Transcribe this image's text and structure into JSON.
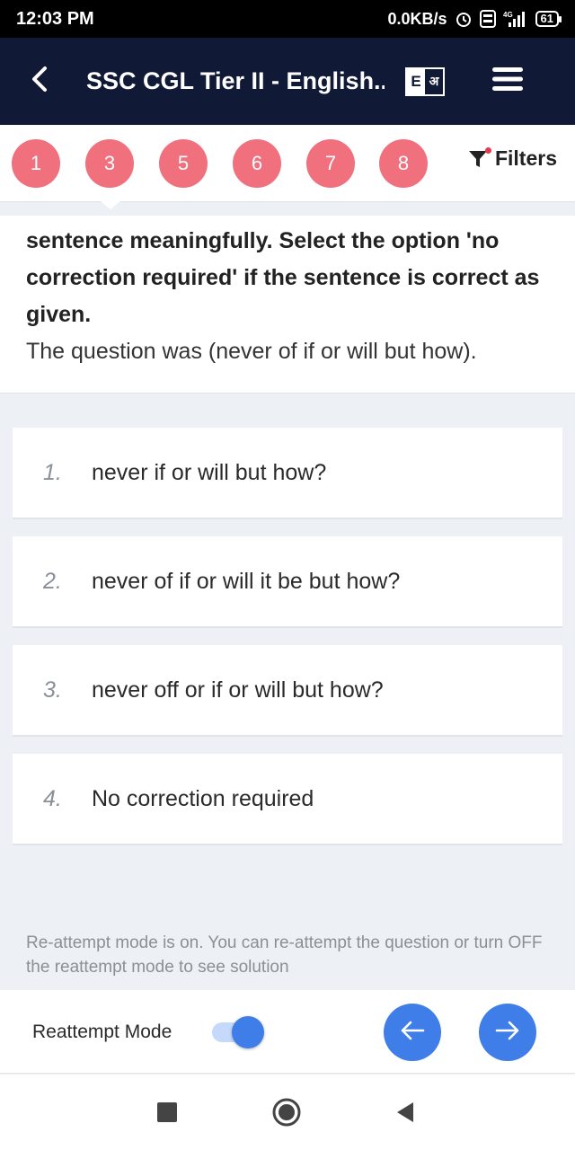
{
  "statusbar": {
    "time": "12:03 PM",
    "net_speed": "0.0KB/s",
    "volte": "Vo LTE",
    "network": "4G",
    "battery": "61"
  },
  "appbar": {
    "title": "SSC CGL Tier II - English...",
    "lang_en": "E",
    "lang_hi": "अ"
  },
  "question_nav": {
    "numbers": [
      "1",
      "3",
      "5",
      "6",
      "7",
      "8"
    ],
    "filters_label": "Filters"
  },
  "question": {
    "instruction": "sentence meaningfully. Select the option 'no correction required' if the sentence is correct as given.",
    "sentence": "The question was (never of if or will but how)."
  },
  "options": [
    {
      "num": "1.",
      "text": "never if or will but how?"
    },
    {
      "num": "2.",
      "text": "never of if or will it be but how?"
    },
    {
      "num": "3.",
      "text": "never off or if or will but how?"
    },
    {
      "num": "4.",
      "text": "No correction required"
    }
  ],
  "note": "Re-attempt mode is on. You can re-attempt the question or turn OFF the reattempt mode to see solution",
  "bottombar": {
    "reattempt_label": "Reattempt Mode",
    "reattempt_on": true
  },
  "colors": {
    "appbar": "#101935",
    "bubble": "#f1707e",
    "accent": "#3f7ee8"
  },
  "icons": {
    "back": "back-arrow-icon",
    "language": "language-toggle-icon",
    "menu": "hamburger-menu-icon",
    "filter": "filter-icon",
    "prev": "arrow-left-icon",
    "next": "arrow-right-icon"
  }
}
